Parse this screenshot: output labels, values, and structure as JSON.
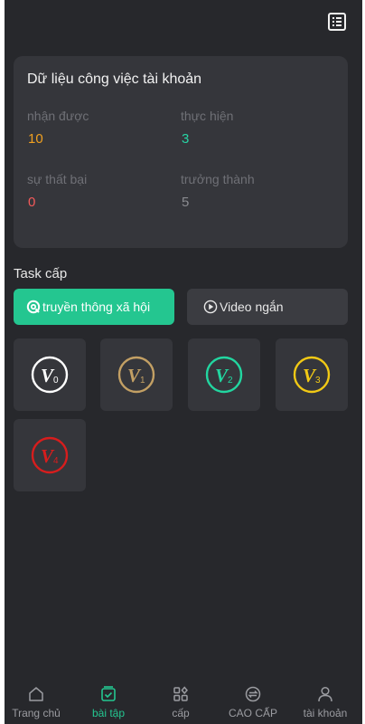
{
  "header": {
    "menu_icon": "list-icon"
  },
  "account_card": {
    "title": "Dữ liệu công việc tài khoản",
    "stats": [
      {
        "label": "nhận được",
        "value": "10",
        "color": "#f0a020"
      },
      {
        "label": "thực hiện",
        "value": "3",
        "color": "#27d4a4"
      },
      {
        "label": "sự thất bại",
        "value": "0",
        "color": "#f45a5a"
      },
      {
        "label": "trưởng thành",
        "value": "5",
        "color": "#8a8b90"
      }
    ]
  },
  "task_level": {
    "title": "Task cấp",
    "tabs": [
      {
        "label": "truyền thông xã hội",
        "icon": "social-icon",
        "active": true
      },
      {
        "label": "Video ngắn",
        "icon": "play-icon",
        "active": false
      }
    ],
    "levels": [
      {
        "badge": "V",
        "sub": "0",
        "color": "#ffffff"
      },
      {
        "badge": "V",
        "sub": "1",
        "color": "#c3a064"
      },
      {
        "badge": "V",
        "sub": "2",
        "color": "#22d6a0"
      },
      {
        "badge": "V",
        "sub": "3",
        "color": "#f1c915"
      },
      {
        "badge": "V",
        "sub": "4",
        "color": "#d71d1d"
      }
    ]
  },
  "bottom_nav": {
    "items": [
      {
        "label": "Trang chủ",
        "icon": "home-icon",
        "active": false
      },
      {
        "label": "bài tập",
        "icon": "task-icon",
        "active": true
      },
      {
        "label": "cấp",
        "icon": "grid-icon",
        "active": false
      },
      {
        "label": "CAO CẤP",
        "icon": "exchange-icon",
        "active": false
      },
      {
        "label": "tài khoản",
        "icon": "user-icon",
        "active": false
      }
    ]
  }
}
